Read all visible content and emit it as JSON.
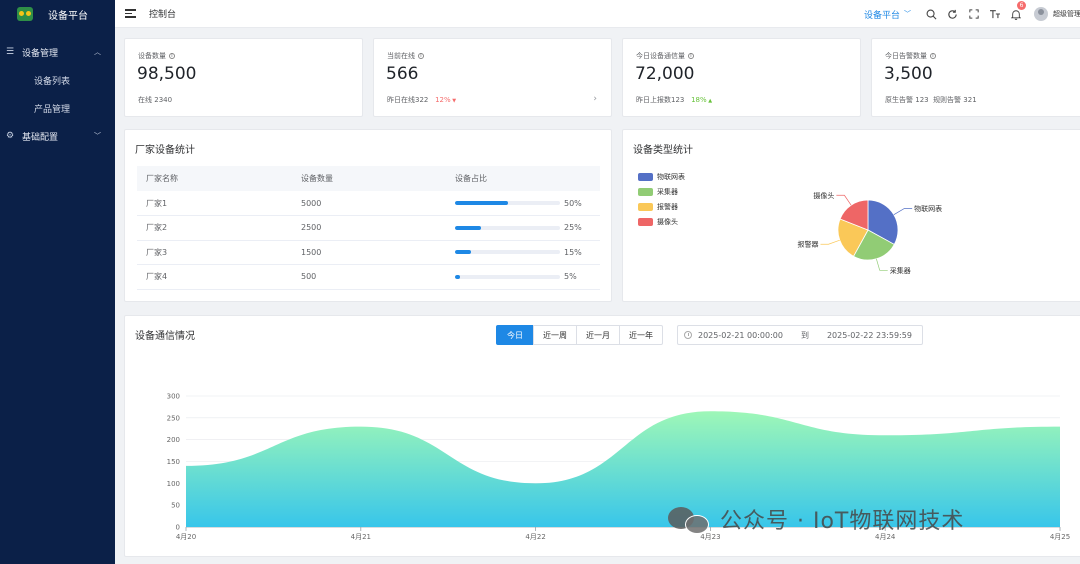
{
  "app": {
    "title": "设备平台"
  },
  "sidebar": {
    "groups": [
      {
        "label": "设备管理",
        "icon": "list-icon",
        "expanded": true,
        "items": [
          {
            "label": "设备列表"
          },
          {
            "label": "产品管理"
          }
        ]
      },
      {
        "label": "基础配置",
        "icon": "gear-icon",
        "expanded": false,
        "items": []
      }
    ]
  },
  "header": {
    "breadcrumb": "控制台",
    "platform_select": "设备平台",
    "notification_count": "6",
    "user_name": "超级管理员"
  },
  "stats": [
    {
      "title": "设备数量",
      "value": "98,500",
      "foot_label": "在线",
      "foot_value": "2340",
      "trend": ""
    },
    {
      "title": "当前在线",
      "value": "566",
      "foot_label": "昨日在线",
      "foot_value": "322",
      "trend": "12%",
      "trend_dir": "down"
    },
    {
      "title": "今日设备通信量",
      "value": "72,000",
      "foot_label": "昨日上报数",
      "foot_value": "123",
      "trend": "18%",
      "trend_dir": "up"
    },
    {
      "title": "今日告警数量",
      "value": "3,500",
      "foot_label": "原生告警",
      "foot_value": "123",
      "foot_label2": "规则告警",
      "foot_value2": "321"
    }
  ],
  "vendor_stats": {
    "title": "厂家设备统计",
    "columns": [
      "厂家名称",
      "设备数量",
      "设备占比"
    ],
    "rows": [
      {
        "name": "厂家1",
        "count": "5000",
        "percent": 50,
        "percent_label": "50%"
      },
      {
        "name": "厂家2",
        "count": "2500",
        "percent": 25,
        "percent_label": "25%"
      },
      {
        "name": "厂家3",
        "count": "1500",
        "percent": 15,
        "percent_label": "15%"
      },
      {
        "name": "厂家4",
        "count": "500",
        "percent": 5,
        "percent_label": "5%"
      }
    ]
  },
  "device_type": {
    "title": "设备类型统计",
    "colors": [
      "#5470c6",
      "#91cc75",
      "#fac858",
      "#ee6666"
    ],
    "chart_data": {
      "type": "pie",
      "labels": [
        "物联网表",
        "采集器",
        "报警器",
        "摄像头"
      ],
      "values": [
        33,
        25,
        23,
        19
      ]
    }
  },
  "traffic": {
    "title": "设备通信情况",
    "ranges": [
      "今日",
      "近一周",
      "近一月",
      "近一年"
    ],
    "active_range": 0,
    "date_start": "2025-02-21 00:00:00",
    "date_sep": "到",
    "date_end": "2025-02-22 23:59:59",
    "chart_data": {
      "type": "area",
      "x": [
        "4月20",
        "4月21",
        "4月22",
        "4月23",
        "4月24",
        "4月25"
      ],
      "values": [
        140,
        230,
        100,
        265,
        210,
        230
      ],
      "ylim": [
        0,
        300
      ],
      "yticks": [
        0,
        50,
        100,
        150,
        200,
        250,
        300
      ],
      "grid": true
    }
  },
  "watermark": {
    "text": "公众号 · IoT物联网技术"
  }
}
